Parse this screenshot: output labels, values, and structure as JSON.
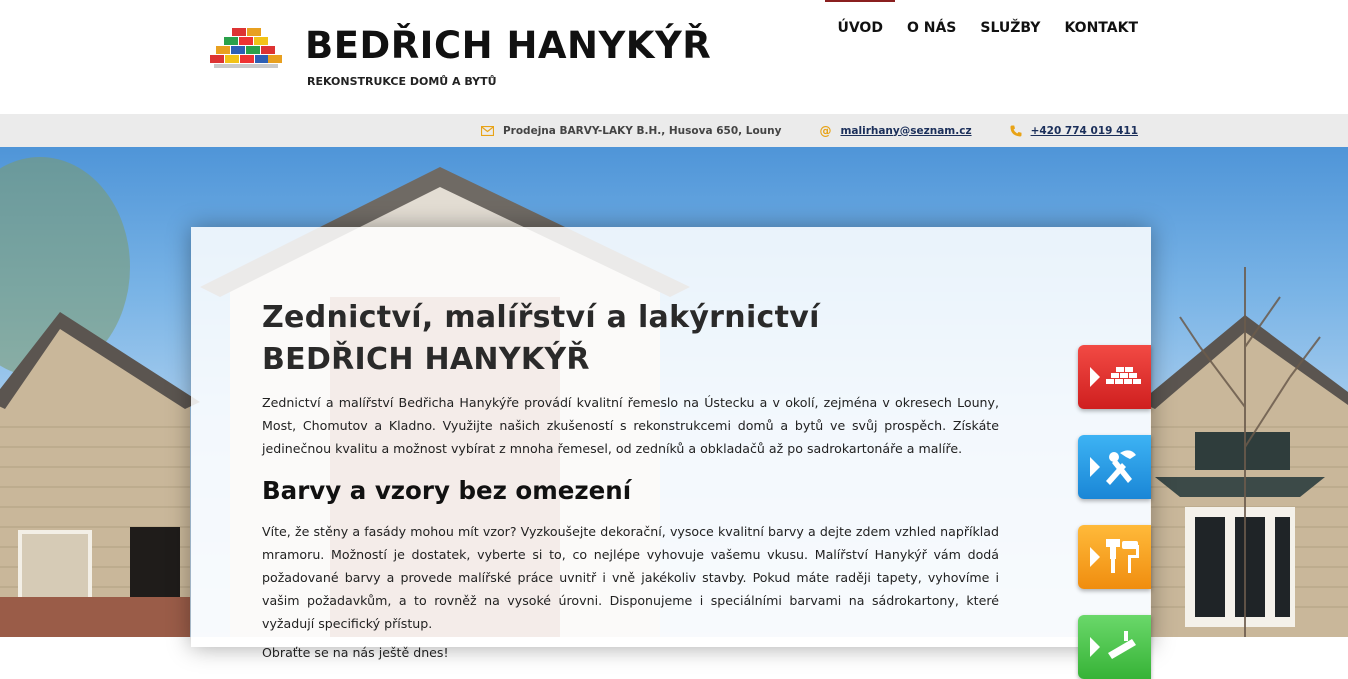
{
  "header": {
    "logo_title": "BEDŘICH HANYKÝŘ",
    "logo_subtitle": "REKONSTRUKCE DOMŮ A BYTŮ",
    "nav": [
      {
        "label": "ÚVOD",
        "active": true
      },
      {
        "label": "O NÁS",
        "active": false
      },
      {
        "label": "SLUŽBY",
        "active": false
      },
      {
        "label": "KONTAKT",
        "active": false
      }
    ],
    "accent_color": "#8a1f1f"
  },
  "infobar": {
    "address": "Prodejna BARVY-LAKY B.H., Husova 650, Louny",
    "address_icon": "envelope-icon",
    "email_symbol": "@",
    "email": "malirhany@seznam.cz",
    "phone": "+420 774 019 411",
    "phone_icon": "phone-icon"
  },
  "content": {
    "title_line1": "Zednictví, malířství a lakýrnictví",
    "title_line2": "BEDŘICH HANYKÝŘ",
    "paragraph1": "Zednictví a malířství Bedřicha Hanykýře provádí kvalitní řemeslo na Ústecku a v okolí, zejména v okresech Louny, Most, Chomutov a Kladno. Využijte našich zkušeností s rekonstrukcemi domů a bytů ve svůj prospěch. Získáte jedinečnou kvalitu a možnost vybírat z mnoha řemesel, od zedníků a obkladačů až po sadrokartonáře a malíře.",
    "heading2": "Barvy a vzory bez omezení",
    "paragraph2": "Víte, že stěny a fasády mohou mít vzor? Vyzkoušejte dekorační, vysoce kvalitní barvy a dejte zdem vzhled například mramoru. Možností je dostatek, vyberte si to, co nejlépe vyhovuje vašemu vkusu. Malířství Hanykýř vám dodá požadované barvy a provede malířské práce uvnitř i vně jakékoliv stavby. Pokud máte raději tapety, vyhovíme i vašim požadavkům, a to rovněž na vysoké úrovni. Disponujeme i speciálními barvami na sádrokartony, které vyžadují specifický přístup.",
    "paragraph3": "Obraťte se na nás ještě dnes!"
  },
  "side_tabs": [
    {
      "icon": "bricks-icon",
      "color": "#e53935"
    },
    {
      "icon": "tools-icon",
      "color": "#2196f3"
    },
    {
      "icon": "paint-roller-icon",
      "color": "#f7a323"
    },
    {
      "icon": "trowel-icon",
      "color": "#4caf50"
    }
  ]
}
